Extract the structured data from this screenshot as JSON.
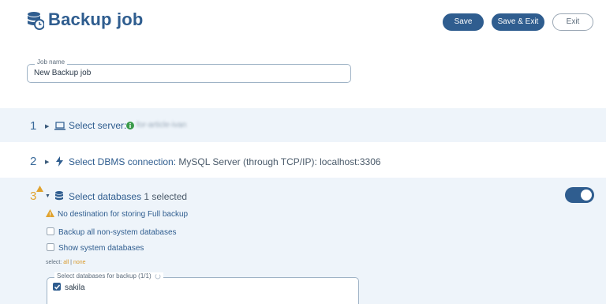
{
  "header": {
    "title": "Backup job",
    "title_icon": "database-clock-icon",
    "buttons": {
      "save": "Save",
      "save_exit": "Save & Exit",
      "exit": "Exit"
    }
  },
  "job_name": {
    "label": "Job name",
    "value": "New Backup job"
  },
  "steps": [
    {
      "number": "1",
      "label": "Select server:",
      "icon": "laptop-icon",
      "info_icon": "info-icon",
      "value": "for-article-ivan"
    },
    {
      "number": "2",
      "label": "Select DBMS connection:",
      "icon": "lightning-icon",
      "value": "MySQL Server (through TCP/IP): localhost:3306"
    },
    {
      "number": "3",
      "label": "Select databases",
      "icon": "database-icon",
      "value": "1 selected",
      "warning_icon": "warning-icon"
    }
  ],
  "databases": {
    "warning": "No destination for storing Full backup",
    "backup_all": {
      "label": "Backup all non-system databases",
      "checked": false
    },
    "show_system": {
      "label": "Show system databases",
      "checked": false
    },
    "select_prefix": "select:",
    "select_all": "all",
    "select_separator": "|",
    "select_none": "none",
    "list_label": "Select databases for backup (1/1)",
    "items": [
      {
        "name": "sakila",
        "checked": true
      }
    ],
    "toggle_on": true
  },
  "colors": {
    "primary": "#2f5d8f",
    "warning": "#e0a22e",
    "step_bg": "#eef4fa"
  }
}
